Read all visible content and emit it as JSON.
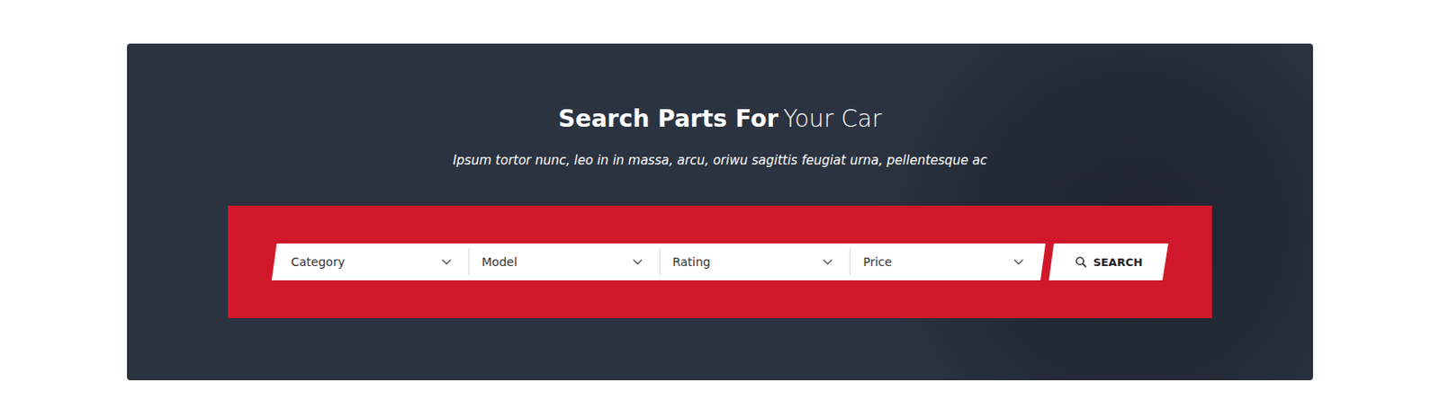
{
  "hero": {
    "title_bold": "Search Parts For",
    "title_light": "Your Car",
    "subtitle": "Ipsum tortor nunc, leo in in massa, arcu, oriwu sagittis feugiat urna, pellentesque ac"
  },
  "filters": [
    {
      "label": "Category"
    },
    {
      "label": "Model"
    },
    {
      "label": "Rating"
    },
    {
      "label": "Price"
    }
  ],
  "search_button": {
    "label": "SEARCH"
  }
}
